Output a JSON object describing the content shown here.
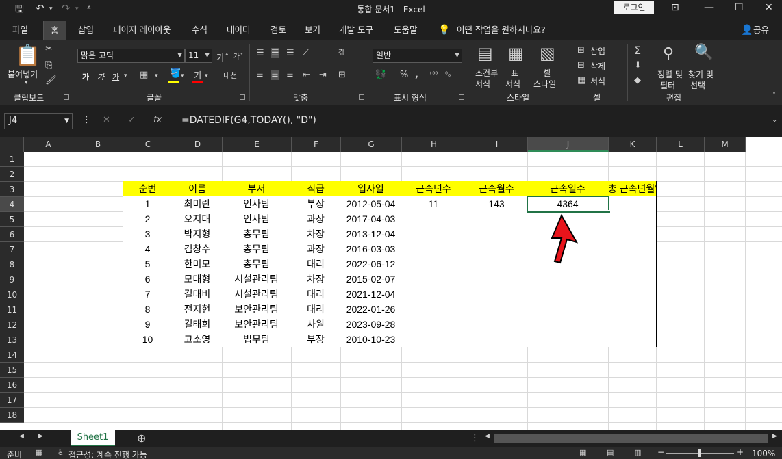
{
  "titlebar": {
    "title": "통합 문서1  -  Excel",
    "login_label": "로그인",
    "save_icon": "floppy-icon",
    "undo_icon": "undo-icon",
    "redo_icon": "redo-icon"
  },
  "tabs": [
    "파일",
    "홈",
    "삽입",
    "페이지 레이아웃",
    "수식",
    "데이터",
    "검토",
    "보기",
    "개발 도구",
    "도움말"
  ],
  "tell_me": "어떤 작업을 원하시나요?",
  "share_label": "공유",
  "ribbon": {
    "clipboard": {
      "paste": "붙여넣기",
      "label": "클립보드"
    },
    "font": {
      "name": "맑은 고딕",
      "size": "11",
      "label": "글꼴",
      "bold": "가",
      "italic": "가",
      "underline": "가"
    },
    "alignment": {
      "label": "맞춤"
    },
    "number": {
      "format": "일반",
      "label": "표시 형식"
    },
    "styles": {
      "conditional": [
        "조건부",
        "서식"
      ],
      "table": [
        "표",
        "서식"
      ],
      "cell": [
        "셀",
        "스타일"
      ],
      "label": "스타일"
    },
    "cells": {
      "insert": "삽입",
      "delete": "삭제",
      "format": "서식",
      "label": "셀"
    },
    "editing": {
      "sort": [
        "정렬 및",
        "필터"
      ],
      "find": [
        "찾기 및",
        "선택"
      ],
      "label": "편집"
    }
  },
  "formula_bar": {
    "name_box": "J4",
    "fx": "fx",
    "formula": "=DATEDIF(G4,TODAY(), \"D\")"
  },
  "columns": [
    "A",
    "B",
    "C",
    "D",
    "E",
    "F",
    "G",
    "H",
    "I",
    "J",
    "K",
    "L",
    "M"
  ],
  "rows": [
    "1",
    "2",
    "3",
    "4",
    "5",
    "6",
    "7",
    "8",
    "9",
    "10",
    "11",
    "12",
    "13",
    "14",
    "15",
    "16",
    "17",
    "18"
  ],
  "table": {
    "headers": [
      "순번",
      "이름",
      "부서",
      "직급",
      "입사일",
      "근속년수",
      "근속월수",
      "근속일수",
      "총 근속년월일수"
    ],
    "rows": [
      [
        "1",
        "최미란",
        "인사팀",
        "부장",
        "2012-05-04",
        "11",
        "143",
        "4364",
        ""
      ],
      [
        "2",
        "오지태",
        "인사팀",
        "과장",
        "2017-04-03",
        "",
        "",
        "",
        ""
      ],
      [
        "3",
        "박지형",
        "총무팀",
        "차장",
        "2013-12-04",
        "",
        "",
        "",
        ""
      ],
      [
        "4",
        "김창수",
        "총무팀",
        "과장",
        "2016-03-03",
        "",
        "",
        "",
        ""
      ],
      [
        "5",
        "한미모",
        "총무팀",
        "대리",
        "2022-06-12",
        "",
        "",
        "",
        ""
      ],
      [
        "6",
        "모태형",
        "시설관리팀",
        "차장",
        "2015-02-07",
        "",
        "",
        "",
        ""
      ],
      [
        "7",
        "길태비",
        "시설관리팀",
        "대리",
        "2021-12-04",
        "",
        "",
        "",
        ""
      ],
      [
        "8",
        "전지현",
        "보안관리팀",
        "대리",
        "2022-01-26",
        "",
        "",
        "",
        ""
      ],
      [
        "9",
        "길태희",
        "보안관리팀",
        "사원",
        "2023-09-28",
        "",
        "",
        "",
        ""
      ],
      [
        "10",
        "고소영",
        "법무팀",
        "부장",
        "2010-10-23",
        "",
        "",
        "",
        ""
      ]
    ]
  },
  "sheet_tab": "Sheet1",
  "status": {
    "ready": "준비",
    "accessibility": "접근성: 계속 진행 가능",
    "zoom": "100%"
  },
  "colors": {
    "header_fill": "#ffff00",
    "selection": "#217346",
    "arrow": "#e8141b"
  }
}
